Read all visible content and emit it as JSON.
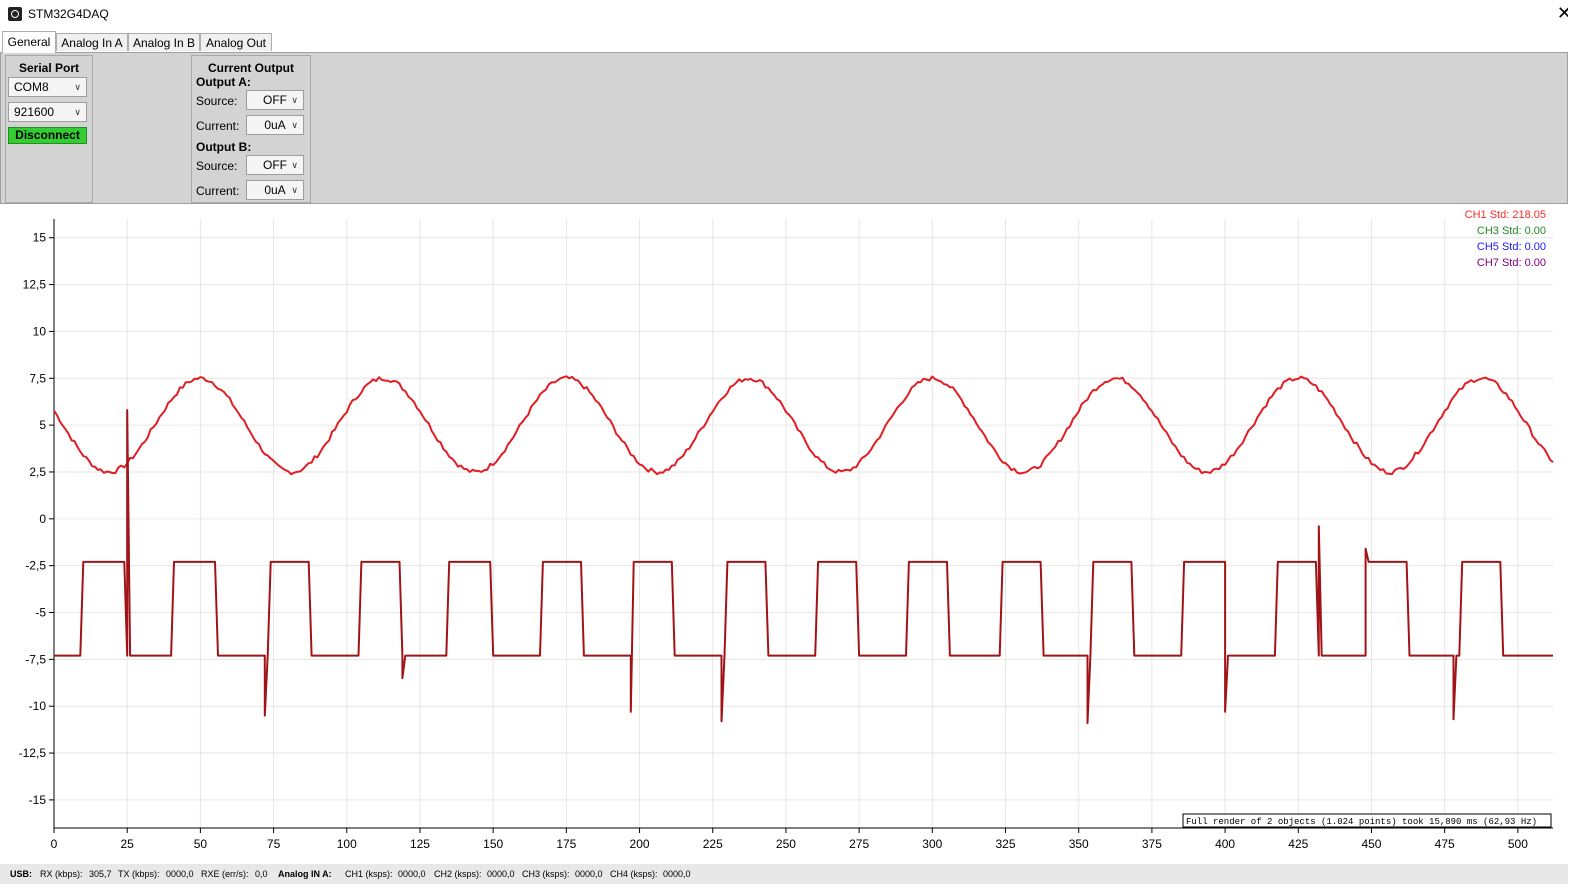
{
  "window": {
    "title": "STM32G4DAQ",
    "close_glyph": "✕"
  },
  "tabs": [
    "General",
    "Analog In A",
    "Analog In B",
    "Analog Out"
  ],
  "serial_port": {
    "title": "Serial Port",
    "port": "COM8",
    "baud": "921600",
    "button": "Disconnect"
  },
  "current_output": {
    "title": "Current Output",
    "output_a": {
      "label": "Output A:",
      "source_label": "Source:",
      "source": "OFF",
      "current_label": "Current:",
      "current": "0uA"
    },
    "output_b": {
      "label": "Output B:",
      "source_label": "Source:",
      "source": "OFF",
      "current_label": "Current:",
      "current": "0uA"
    }
  },
  "chart_data": {
    "type": "line",
    "xlim": [
      0,
      512
    ],
    "ylim": [
      -16.5,
      16
    ],
    "x_ticks": [
      0,
      25,
      50,
      75,
      100,
      125,
      150,
      175,
      200,
      225,
      250,
      275,
      300,
      325,
      350,
      375,
      400,
      425,
      450,
      475,
      500
    ],
    "y_ticks": [
      15,
      12.5,
      10,
      7.5,
      5,
      2.5,
      0,
      -2.5,
      -5,
      -7.5,
      -10,
      -12.5,
      -15
    ],
    "y_tick_labels": [
      "15",
      "12,5",
      "10",
      "7,5",
      "5",
      "2,5",
      "0",
      "-2,5",
      "-5",
      "-7,5",
      "-10",
      "-12,5",
      "-15"
    ],
    "grid": true,
    "legend": [
      {
        "text": "CH1 Std: 218.05",
        "color": "#ff2a2a"
      },
      {
        "text": "CH3 Std: 0.00",
        "color": "#228b22"
      },
      {
        "text": "CH5 Std: 0.00",
        "color": "#1a1aff"
      },
      {
        "text": "CH7 Std: 0.00",
        "color": "#800080"
      }
    ],
    "legend_position": "top-right",
    "annotation": "Full render of 2 objects (1.024 points) took 15,890 ms (62,93 Hz)",
    "series": [
      {
        "color": "#e01e24",
        "kind": "sine",
        "period": 62.5,
        "center": 5.0,
        "amplitude": 2.5,
        "peak_x": 50,
        "x_range": [
          0,
          512
        ]
      },
      {
        "color": "#a01418",
        "kind": "square",
        "high": -2.3,
        "low": -7.3,
        "high_intervals": [
          [
            10,
            25
          ],
          [
            41,
            56
          ],
          [
            74,
            88
          ],
          [
            105,
            119
          ],
          [
            135,
            150
          ],
          [
            167,
            181
          ],
          [
            198,
            212
          ],
          [
            230,
            244
          ],
          [
            261,
            275
          ],
          [
            292,
            306
          ],
          [
            324,
            338
          ],
          [
            355,
            369
          ],
          [
            386,
            401
          ],
          [
            418,
            432
          ],
          [
            449,
            463
          ],
          [
            481,
            495
          ]
        ],
        "spikes": [
          {
            "x": 25,
            "y": 5.8
          },
          {
            "x": 72,
            "y": -10.5
          },
          {
            "x": 119,
            "y": -8.5
          },
          {
            "x": 197,
            "y": -10.3
          },
          {
            "x": 228,
            "y": -10.8
          },
          {
            "x": 353,
            "y": -10.9
          },
          {
            "x": 400,
            "y": -10.3
          },
          {
            "x": 432,
            "y": -0.4
          },
          {
            "x": 448,
            "y": -1.6
          },
          {
            "x": 478,
            "y": -10.7
          }
        ],
        "x_range": [
          0,
          512
        ]
      }
    ]
  },
  "status": {
    "usb_label": "USB:",
    "rx_label": "RX (kbps):",
    "rx": "305,7",
    "tx_label": "TX (kbps):",
    "tx": "0000,0",
    "rxe_label": "RXE (err/s):",
    "rxe": "0,0",
    "ain_label": "Analog IN A:",
    "ch1_label": "CH1 (ksps):",
    "ch1": "0000,0",
    "ch2_label": "CH2 (ksps):",
    "ch2": "0000,0",
    "ch3_label": "CH3 (ksps):",
    "ch3": "0000,0",
    "ch4_label": "CH4 (ksps):",
    "ch4": "0000,0"
  }
}
